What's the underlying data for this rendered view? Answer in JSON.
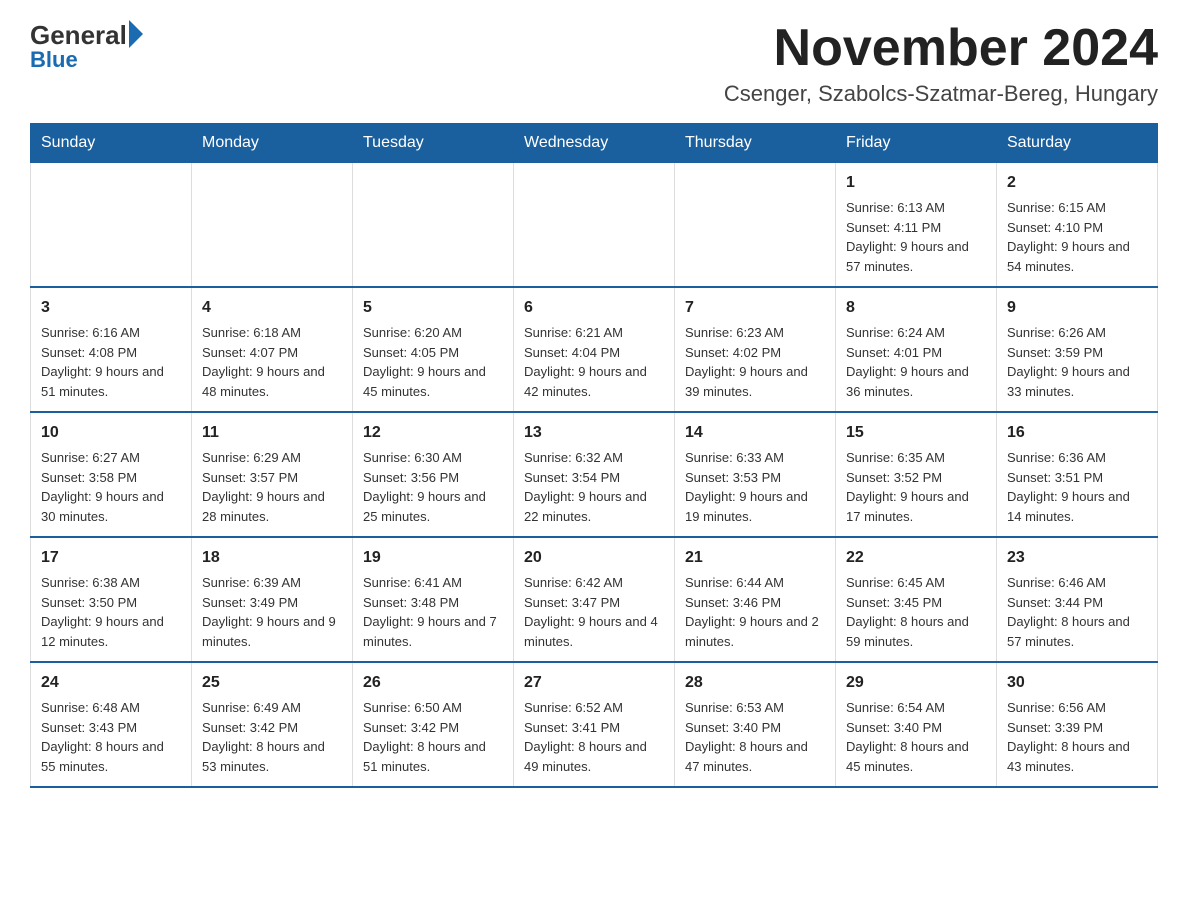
{
  "logo": {
    "text_general": "General",
    "text_blue": "Blue"
  },
  "header": {
    "title": "November 2024",
    "subtitle": "Csenger, Szabolcs-Szatmar-Bereg, Hungary"
  },
  "weekdays": [
    "Sunday",
    "Monday",
    "Tuesday",
    "Wednesday",
    "Thursday",
    "Friday",
    "Saturday"
  ],
  "weeks": [
    [
      {
        "day": "",
        "info": ""
      },
      {
        "day": "",
        "info": ""
      },
      {
        "day": "",
        "info": ""
      },
      {
        "day": "",
        "info": ""
      },
      {
        "day": "",
        "info": ""
      },
      {
        "day": "1",
        "info": "Sunrise: 6:13 AM\nSunset: 4:11 PM\nDaylight: 9 hours and 57 minutes."
      },
      {
        "day": "2",
        "info": "Sunrise: 6:15 AM\nSunset: 4:10 PM\nDaylight: 9 hours and 54 minutes."
      }
    ],
    [
      {
        "day": "3",
        "info": "Sunrise: 6:16 AM\nSunset: 4:08 PM\nDaylight: 9 hours and 51 minutes."
      },
      {
        "day": "4",
        "info": "Sunrise: 6:18 AM\nSunset: 4:07 PM\nDaylight: 9 hours and 48 minutes."
      },
      {
        "day": "5",
        "info": "Sunrise: 6:20 AM\nSunset: 4:05 PM\nDaylight: 9 hours and 45 minutes."
      },
      {
        "day": "6",
        "info": "Sunrise: 6:21 AM\nSunset: 4:04 PM\nDaylight: 9 hours and 42 minutes."
      },
      {
        "day": "7",
        "info": "Sunrise: 6:23 AM\nSunset: 4:02 PM\nDaylight: 9 hours and 39 minutes."
      },
      {
        "day": "8",
        "info": "Sunrise: 6:24 AM\nSunset: 4:01 PM\nDaylight: 9 hours and 36 minutes."
      },
      {
        "day": "9",
        "info": "Sunrise: 6:26 AM\nSunset: 3:59 PM\nDaylight: 9 hours and 33 minutes."
      }
    ],
    [
      {
        "day": "10",
        "info": "Sunrise: 6:27 AM\nSunset: 3:58 PM\nDaylight: 9 hours and 30 minutes."
      },
      {
        "day": "11",
        "info": "Sunrise: 6:29 AM\nSunset: 3:57 PM\nDaylight: 9 hours and 28 minutes."
      },
      {
        "day": "12",
        "info": "Sunrise: 6:30 AM\nSunset: 3:56 PM\nDaylight: 9 hours and 25 minutes."
      },
      {
        "day": "13",
        "info": "Sunrise: 6:32 AM\nSunset: 3:54 PM\nDaylight: 9 hours and 22 minutes."
      },
      {
        "day": "14",
        "info": "Sunrise: 6:33 AM\nSunset: 3:53 PM\nDaylight: 9 hours and 19 minutes."
      },
      {
        "day": "15",
        "info": "Sunrise: 6:35 AM\nSunset: 3:52 PM\nDaylight: 9 hours and 17 minutes."
      },
      {
        "day": "16",
        "info": "Sunrise: 6:36 AM\nSunset: 3:51 PM\nDaylight: 9 hours and 14 minutes."
      }
    ],
    [
      {
        "day": "17",
        "info": "Sunrise: 6:38 AM\nSunset: 3:50 PM\nDaylight: 9 hours and 12 minutes."
      },
      {
        "day": "18",
        "info": "Sunrise: 6:39 AM\nSunset: 3:49 PM\nDaylight: 9 hours and 9 minutes."
      },
      {
        "day": "19",
        "info": "Sunrise: 6:41 AM\nSunset: 3:48 PM\nDaylight: 9 hours and 7 minutes."
      },
      {
        "day": "20",
        "info": "Sunrise: 6:42 AM\nSunset: 3:47 PM\nDaylight: 9 hours and 4 minutes."
      },
      {
        "day": "21",
        "info": "Sunrise: 6:44 AM\nSunset: 3:46 PM\nDaylight: 9 hours and 2 minutes."
      },
      {
        "day": "22",
        "info": "Sunrise: 6:45 AM\nSunset: 3:45 PM\nDaylight: 8 hours and 59 minutes."
      },
      {
        "day": "23",
        "info": "Sunrise: 6:46 AM\nSunset: 3:44 PM\nDaylight: 8 hours and 57 minutes."
      }
    ],
    [
      {
        "day": "24",
        "info": "Sunrise: 6:48 AM\nSunset: 3:43 PM\nDaylight: 8 hours and 55 minutes."
      },
      {
        "day": "25",
        "info": "Sunrise: 6:49 AM\nSunset: 3:42 PM\nDaylight: 8 hours and 53 minutes."
      },
      {
        "day": "26",
        "info": "Sunrise: 6:50 AM\nSunset: 3:42 PM\nDaylight: 8 hours and 51 minutes."
      },
      {
        "day": "27",
        "info": "Sunrise: 6:52 AM\nSunset: 3:41 PM\nDaylight: 8 hours and 49 minutes."
      },
      {
        "day": "28",
        "info": "Sunrise: 6:53 AM\nSunset: 3:40 PM\nDaylight: 8 hours and 47 minutes."
      },
      {
        "day": "29",
        "info": "Sunrise: 6:54 AM\nSunset: 3:40 PM\nDaylight: 8 hours and 45 minutes."
      },
      {
        "day": "30",
        "info": "Sunrise: 6:56 AM\nSunset: 3:39 PM\nDaylight: 8 hours and 43 minutes."
      }
    ]
  ]
}
